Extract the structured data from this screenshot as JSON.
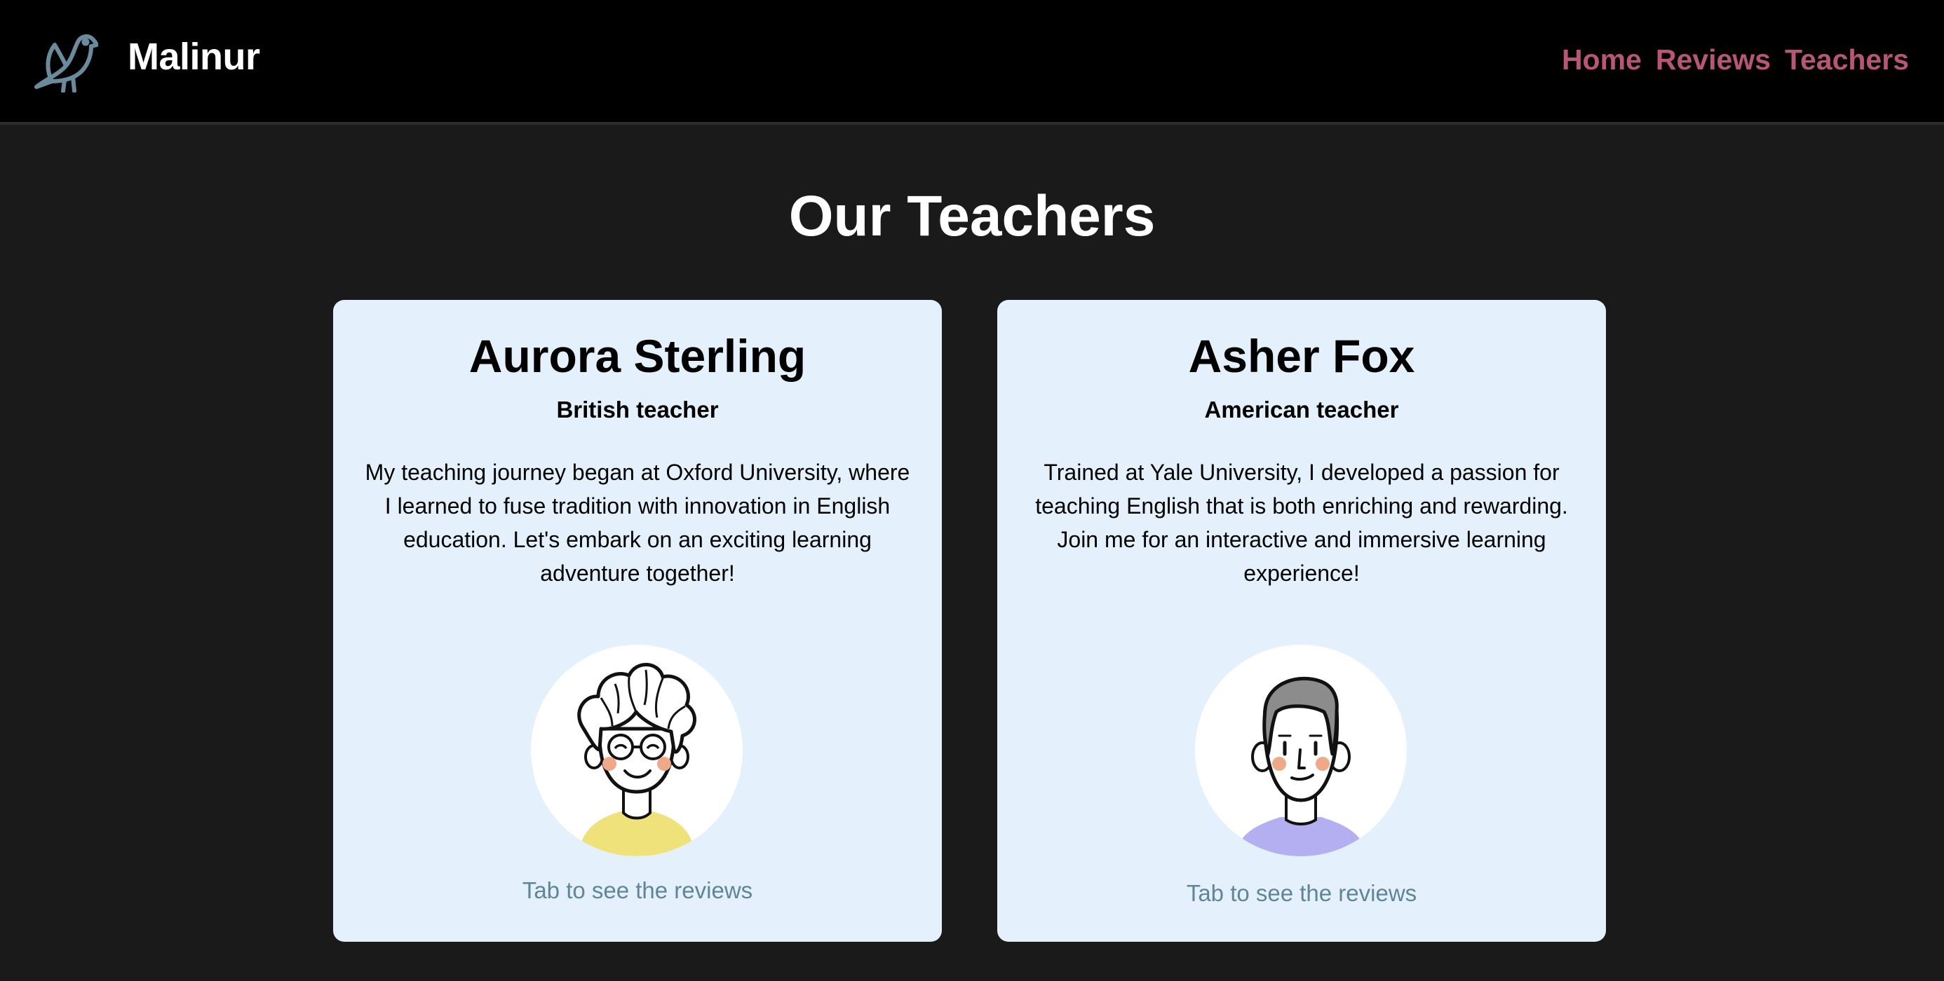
{
  "header": {
    "brand": "Malinur",
    "logo_icon": "bird-icon",
    "nav": [
      {
        "label": "Home"
      },
      {
        "label": "Reviews"
      },
      {
        "label": "Teachers"
      }
    ]
  },
  "main": {
    "title": "Our Teachers",
    "teachers": [
      {
        "name": "Aurora Sterling",
        "role": "British teacher",
        "bio": "My teaching journey began at Oxford University, where I learned to fuse tradition with innovation in English education. Let's embark on an exciting learning adventure together!",
        "avatar_icon": "curly-hair-glasses-avatar-icon",
        "hint": "Tab to see the reviews"
      },
      {
        "name": "Asher Fox",
        "role": "American teacher",
        "bio": "Trained at Yale University, I developed a passion for teaching English that is both enriching and rewarding. Join me for an interactive and immersive learning experience!",
        "avatar_icon": "short-hair-avatar-icon",
        "hint": "Tab to see the reviews"
      }
    ]
  },
  "colors": {
    "header_bg": "#000000",
    "page_bg": "#1a1a1a",
    "nav_link": "#b85678",
    "card_bg": "#e4f1fc",
    "hint_text": "#5f8597",
    "logo": "#6b8a9c"
  }
}
